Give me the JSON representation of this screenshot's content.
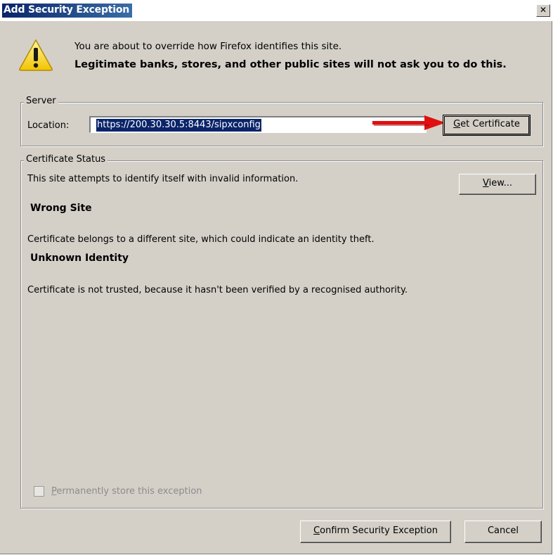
{
  "window": {
    "title": "Add Security Exception",
    "close_glyph": "✕"
  },
  "intro": {
    "line1": "You are about to override how Firefox identifies this site.",
    "line2": "Legitimate banks, stores, and other public sites will not ask you to do this.",
    "icon": "warning-icon"
  },
  "server": {
    "legend": "Server",
    "location_label": "Location:",
    "location_value": "https://200.30.30.5:8443/sipxconfig",
    "get_cert_prefix": "G",
    "get_cert_rest": "et Certificate"
  },
  "status": {
    "legend": "Certificate Status",
    "intro": "This site attempts to identify itself with invalid information.",
    "view_prefix": "V",
    "view_rest": "iew...",
    "items": [
      {
        "heading": "Wrong Site",
        "detail": "Certificate belongs to a different site, which could indicate an identity theft."
      },
      {
        "heading": "Unknown Identity",
        "detail": "Certificate is not trusted, because it hasn't been verified by a recognised authority."
      }
    ],
    "perm_prefix": "P",
    "perm_rest": "ermanently store this exception"
  },
  "footer": {
    "confirm_prefix": "C",
    "confirm_rest": "onfirm Security Exception",
    "cancel": "Cancel"
  },
  "colors": {
    "title_bg": "#0a246a",
    "dialog_bg": "#d4d0c8",
    "arrow": "#e01010"
  }
}
